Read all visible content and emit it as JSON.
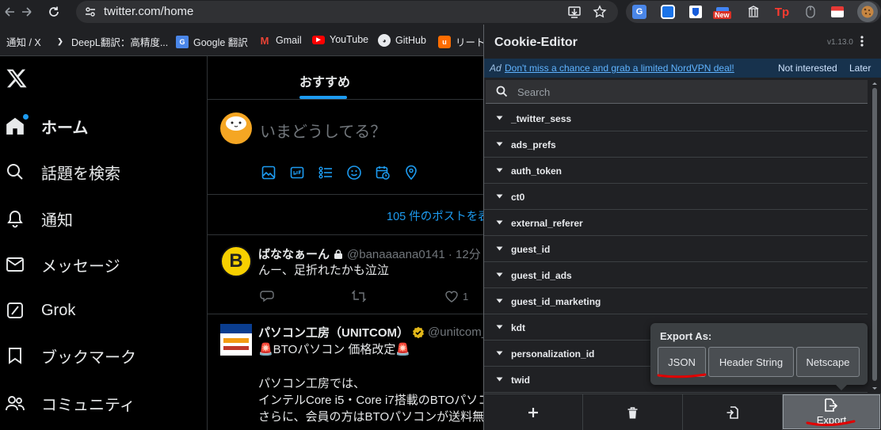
{
  "browser": {
    "url": "twitter.com/home",
    "new_badge": "New",
    "bookmarks": [
      {
        "label": "通知 / X"
      },
      {
        "label": "DeepL翻訳：高精度..."
      },
      {
        "label": "Google 翻訳"
      },
      {
        "label": "Gmail"
      },
      {
        "label": "YouTube"
      },
      {
        "label": "GitHub"
      },
      {
        "label": "リートン"
      }
    ]
  },
  "x": {
    "nav": [
      {
        "label": "ホーム",
        "icon": "home-icon",
        "active": true
      },
      {
        "label": "話題を検索",
        "icon": "search-icon"
      },
      {
        "label": "通知",
        "icon": "bell-icon"
      },
      {
        "label": "メッセージ",
        "icon": "mail-icon"
      },
      {
        "label": "Grok",
        "icon": "grok-icon"
      },
      {
        "label": "ブックマーク",
        "icon": "bookmark-icon"
      },
      {
        "label": "コミュニティ",
        "icon": "community-icon"
      }
    ],
    "feed": {
      "tab": "おすすめ",
      "composer_placeholder": "いまどうしてる？",
      "show_new_posts": "105 件のポストを表",
      "posts": [
        {
          "name": "ばななぁーん",
          "handle": "@banaaaana0141 · 12分",
          "text": "んー、足折れたかも泣泣",
          "likes": "1"
        },
        {
          "name": "パソコン工房（UNITCOM）",
          "handle": "@unitcom_i",
          "lines": [
            "🚨BTOパソコン 価格改定🚨",
            "",
            "パソコン工房では、",
            "インテルCore i5・Core i7搭載のBTOパソコ",
            "さらに、会員の方はBTOパソコンが送料無"
          ]
        }
      ]
    }
  },
  "cookie_editor": {
    "title": "Cookie-Editor",
    "version": "v1.13.0",
    "ad": {
      "tag": "Ad",
      "message": "Don't miss a chance and grab a limited NordVPN deal!",
      "not_interested": "Not interested",
      "later": "Later"
    },
    "search_placeholder": "Search",
    "cookies": [
      "_twitter_sess",
      "ads_prefs",
      "auth_token",
      "ct0",
      "external_referer",
      "guest_id",
      "guest_id_ads",
      "guest_id_marketing",
      "kdt",
      "personalization_id",
      "twid"
    ],
    "export_label": "Export",
    "export_menu": {
      "title": "Export As:",
      "options": [
        "JSON",
        "Header String",
        "Netscape"
      ]
    },
    "annotation_color": "#e00000"
  }
}
